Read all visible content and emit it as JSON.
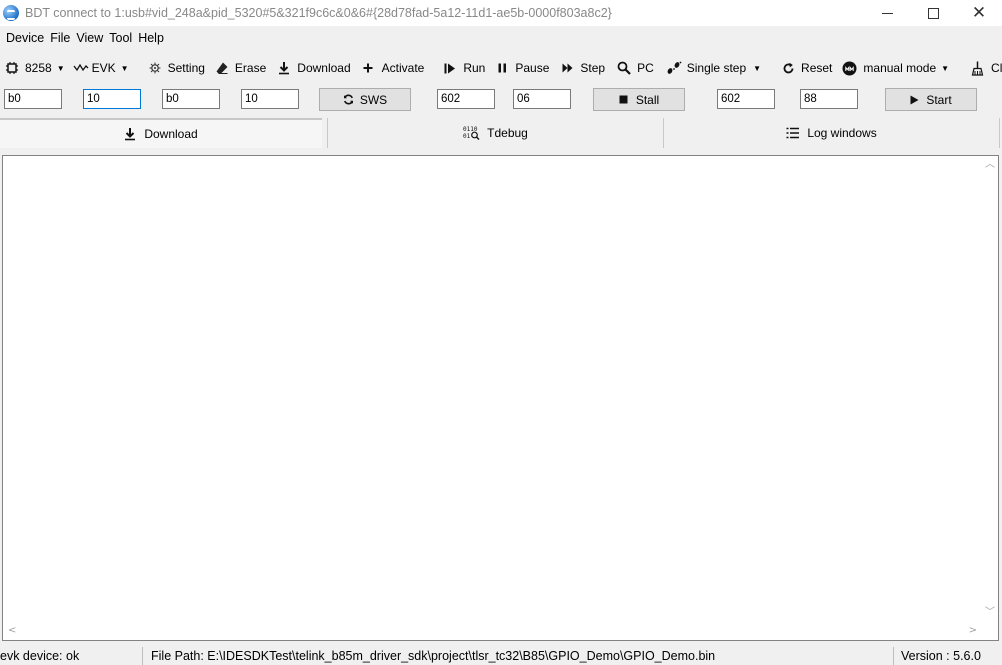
{
  "window": {
    "title": "BDT connect to 1:usb#vid_248a&pid_5320#5&321f9c6c&0&6#{28d78fad-5a12-11d1-ae5b-0000f803a8c2}"
  },
  "menu": [
    "Device",
    "File",
    "View",
    "Tool",
    "Help"
  ],
  "toolbar": {
    "chip": "8258",
    "board": "EVK",
    "setting": "Setting",
    "erase": "Erase",
    "download": "Download",
    "activate": "Activate",
    "run": "Run",
    "pause": "Pause",
    "step": "Step",
    "pc": "PC",
    "single_step": "Single step",
    "reset": "Reset",
    "manual_mode": "manual mode",
    "clear": "Clear"
  },
  "inputs": {
    "f1": "b0",
    "f2": "10",
    "f3": "b0",
    "f4": "10",
    "sws_label": "SWS",
    "f5": "602",
    "f6": "06",
    "stall_label": "Stall",
    "f7": "602",
    "f8": "88",
    "start_label": "Start"
  },
  "tabs": {
    "download": "Download",
    "tdebug": "Tdebug",
    "log_windows": "Log windows"
  },
  "status": {
    "device": "evk device: ok",
    "file_path": "File Path:  E:\\IDESDKTest\\telink_b85m_driver_sdk\\project\\tlsr_tc32\\B85\\GPIO_Demo\\GPIO_Demo.bin",
    "version": "Version : 5.6.0"
  },
  "colors": {
    "focus_border": "#0078d7",
    "background": "#f0f0f0"
  }
}
